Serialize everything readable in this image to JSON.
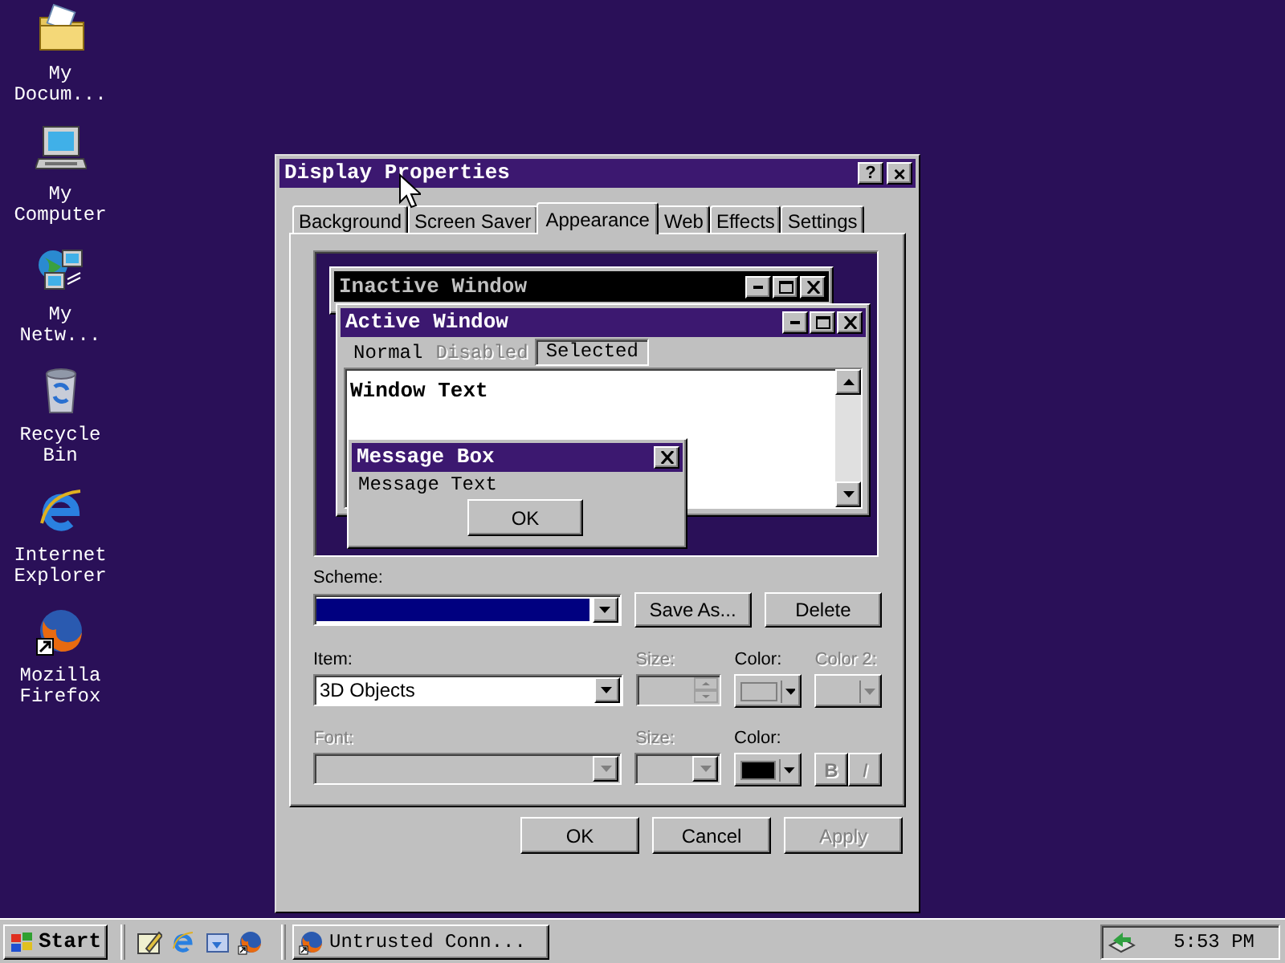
{
  "desktop_icons": [
    {
      "label": "My\nDocum...",
      "kind": "folder"
    },
    {
      "label": "My\nComputer",
      "kind": "computer"
    },
    {
      "label": "My\nNetw...",
      "kind": "network"
    },
    {
      "label": "Recycle\nBin",
      "kind": "bin"
    },
    {
      "label": "Internet\nExplorer",
      "kind": "ie"
    },
    {
      "label": "Mozilla\nFirefox",
      "kind": "firefox"
    }
  ],
  "dialog": {
    "title": "Display Properties",
    "help": "?",
    "close": "×",
    "tabs": [
      {
        "label": "Background",
        "selected": false
      },
      {
        "label": "Screen Saver",
        "selected": false
      },
      {
        "label": "Appearance",
        "selected": true
      },
      {
        "label": "Web",
        "selected": false
      },
      {
        "label": "Effects",
        "selected": false
      },
      {
        "label": "Settings",
        "selected": false
      }
    ],
    "preview": {
      "inactive_title": "Inactive Window",
      "active_title": "Active Window",
      "menu": [
        {
          "label": "Normal",
          "kind": "normal"
        },
        {
          "label": "Disabled",
          "kind": "disabled"
        },
        {
          "label": "Selected",
          "kind": "selected"
        }
      ],
      "window_text": "Window Text",
      "message_title": "Message Box",
      "message_text": "Message Text",
      "ok": "OK"
    },
    "scheme": {
      "label": "Scheme:",
      "highlighted": true
    },
    "scheme_buttons": [
      {
        "label": "Save As...",
        "disabled": false
      },
      {
        "label": "Delete",
        "disabled": false
      }
    ],
    "item": {
      "label": "Item:",
      "value": "3D Objects"
    },
    "item_size": {
      "label": "Size:",
      "disabled": true
    },
    "item_color": {
      "label": "Color:",
      "color": "#c0c0c0",
      "disabled": false
    },
    "item_color2": {
      "label": "Color 2:",
      "disabled": true
    },
    "font": {
      "label": "Font:",
      "disabled": true
    },
    "font_size": {
      "label": "Size:",
      "disabled": true
    },
    "font_color": {
      "label": "Color:",
      "color": "#000000",
      "disabled": false
    },
    "style_buttons": [
      {
        "label": "B",
        "disabled": true
      },
      {
        "label": "I",
        "disabled": true
      }
    ],
    "buttons": [
      {
        "label": "OK",
        "disabled": false
      },
      {
        "label": "Cancel",
        "disabled": false
      },
      {
        "label": "Apply",
        "disabled": true
      }
    ]
  },
  "taskbar": {
    "start": "Start",
    "quick_launch": [
      {
        "kind": "desktop"
      },
      {
        "kind": "ie"
      },
      {
        "kind": "channels"
      },
      {
        "kind": "firefox"
      }
    ],
    "tasks": [
      {
        "label": "Untrusted Conn...",
        "selected": false
      }
    ],
    "clock": "5:53 PM"
  }
}
